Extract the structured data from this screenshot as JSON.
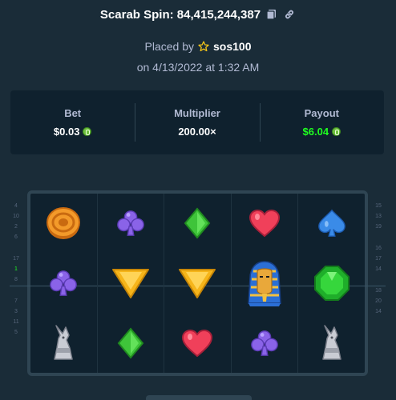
{
  "header": {
    "title": "Scarab Spin: 84,415,244,387",
    "copy_icon": "copy-icon",
    "link_icon": "link-icon"
  },
  "placed": {
    "prefix": "Placed by",
    "user": "sos100",
    "date": "on 4/13/2022 at 1:32 AM"
  },
  "stats": {
    "bet_label": "Bet",
    "bet_value": "$0.03",
    "multiplier_label": "Multiplier",
    "multiplier_value": "200.00×",
    "payout_label": "Payout",
    "payout_value": "$6.04",
    "payout_color": "#1fff20"
  },
  "reels": [
    [
      "scarab-coin",
      "clover",
      "anubis"
    ],
    [
      "clover",
      "triangle",
      "diamond"
    ],
    [
      "diamond",
      "triangle",
      "heart"
    ],
    [
      "heart",
      "pharaoh",
      "clover"
    ],
    [
      "spade",
      "emerald",
      "anubis"
    ]
  ],
  "left_numbers": [
    [
      "4",
      "10",
      "2",
      "6"
    ],
    [
      "17",
      "1",
      "8"
    ],
    [
      "7",
      "3",
      "11",
      "5"
    ]
  ],
  "right_numbers": [
    [
      "15",
      "13",
      "19"
    ],
    [
      "16",
      "17",
      "14"
    ],
    [
      "18",
      "20",
      "14"
    ]
  ]
}
